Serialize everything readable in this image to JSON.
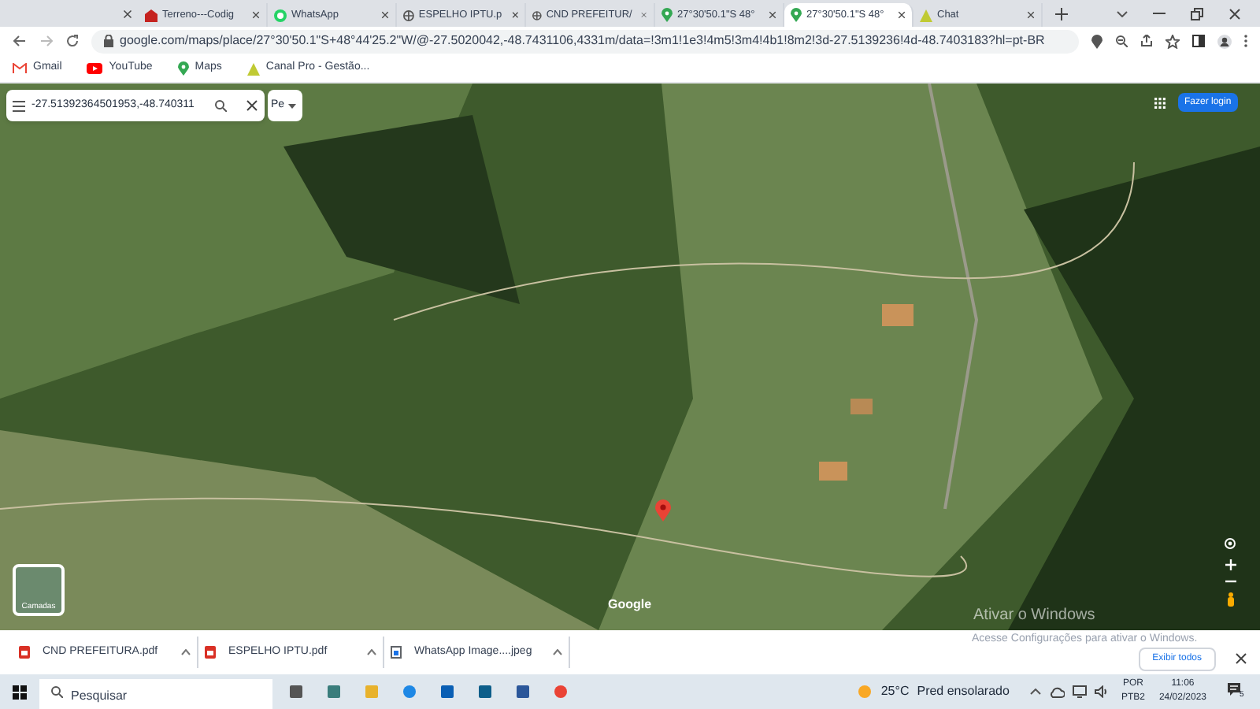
{
  "tabs": [
    {
      "title": "Terreno---Codig",
      "selected": false
    },
    {
      "title": "WhatsApp",
      "selected": false
    },
    {
      "title": "ESPELHO IPTU.p",
      "selected": false
    },
    {
      "title": "CND PREFEITUR/",
      "selected": false
    },
    {
      "title": "27°30'50.1\"S 48°",
      "selected": false
    },
    {
      "title": "27°30'50.1\"S 48°",
      "selected": true
    },
    {
      "title": "Chat",
      "selected": false
    }
  ],
  "address_bar": {
    "url": "google.com/maps/place/27°30'50.1\"S+48°44'25.2\"W/@-27.5020042,-48.7431106,4331m/data=!3m1!1e3!4m5!3m4!4b1!8m2!3d-27.5139236!4d-48.7403183?hl=pt-BR"
  },
  "bookmarks": [
    {
      "label": "Gmail"
    },
    {
      "label": "YouTube"
    },
    {
      "label": "Maps"
    },
    {
      "label": "Canal Pro - Gestão..."
    }
  ],
  "map": {
    "search_value": "-27.51392364501953,-48.740311",
    "dropdown": "Pe",
    "login_button": "Fazer login",
    "layers_label": "Camadas",
    "attribution": "Google"
  },
  "activation": {
    "title": "Ativar o Windows",
    "subtitle": "Acesse Configurações para ativar o Windows."
  },
  "downloads": {
    "files": [
      {
        "name": "CND PREFEITURA.pdf",
        "kind": "pdf"
      },
      {
        "name": "ESPELHO IPTU.pdf",
        "kind": "pdf"
      },
      {
        "name": "WhatsApp Image....jpeg",
        "kind": "image"
      }
    ],
    "show_all": "Exibir todos"
  },
  "taskbar": {
    "search_placeholder": "Pesquisar",
    "temperature": "25°C",
    "weather": "Pred ensolarado",
    "language": "POR",
    "layout": "PTB2",
    "time": "11:06",
    "date": "24/02/2023",
    "notifications": "5"
  }
}
